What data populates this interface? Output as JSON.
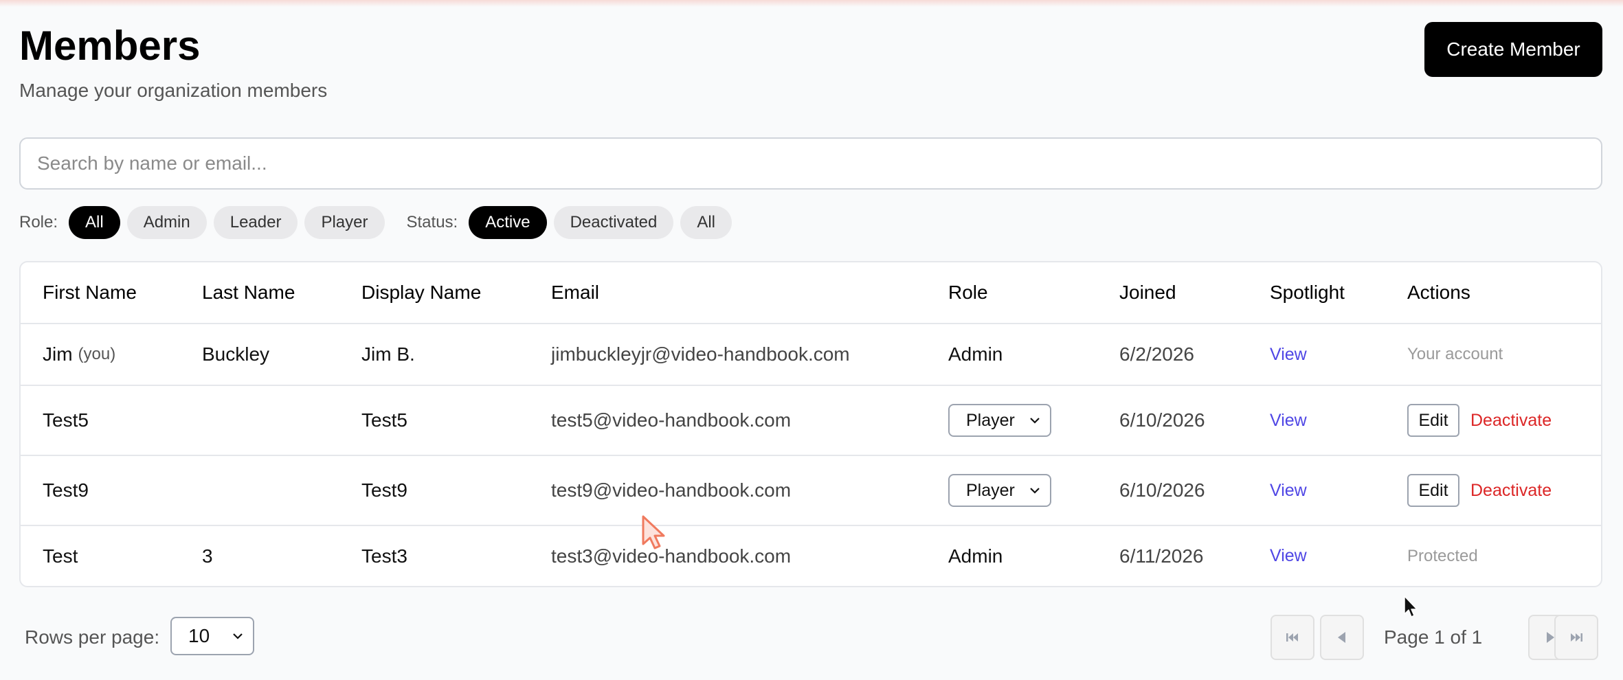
{
  "header": {
    "title": "Members",
    "subtitle": "Manage your organization members",
    "create_button": "Create Member"
  },
  "search": {
    "placeholder": "Search by name or email...",
    "value": ""
  },
  "filters": {
    "role_label": "Role:",
    "role_options": [
      "All",
      "Admin",
      "Leader",
      "Player"
    ],
    "role_selected": "All",
    "status_label": "Status:",
    "status_options": [
      "Active",
      "Deactivated",
      "All"
    ],
    "status_selected": "Active"
  },
  "table": {
    "columns": [
      "First Name",
      "Last Name",
      "Display Name",
      "Email",
      "Role",
      "Joined",
      "Spotlight",
      "Actions"
    ],
    "rows": [
      {
        "first_name": "Jim",
        "you_tag": "(you)",
        "last_name": "Buckley",
        "display_name": "Jim B.",
        "email": "jimbuckleyjr@video-handbook.com",
        "role": "Admin",
        "joined": "6/2/2026",
        "spotlight": "View",
        "action_text": "Your account"
      },
      {
        "first_name": "Test5",
        "last_name": "",
        "display_name": "Test5",
        "email": "test5@video-handbook.com",
        "role": "Player",
        "joined": "6/10/2026",
        "spotlight": "View",
        "edit_label": "Edit",
        "deactivate_label": "Deactivate"
      },
      {
        "first_name": "Test9",
        "last_name": "",
        "display_name": "Test9",
        "email": "test9@video-handbook.com",
        "role": "Player",
        "joined": "6/10/2026",
        "spotlight": "View",
        "edit_label": "Edit",
        "deactivate_label": "Deactivate"
      },
      {
        "first_name": "Test",
        "last_name": "3",
        "display_name": "Test3",
        "email": "test3@video-handbook.com",
        "role": "Admin",
        "joined": "6/11/2026",
        "spotlight": "View",
        "action_text": "Protected"
      }
    ]
  },
  "pagination": {
    "rows_per_page_label": "Rows per page:",
    "rows_per_page": "10",
    "page_info": "Page 1 of 1"
  },
  "colors": {
    "accent": "#000000",
    "link": "#4f46e5",
    "danger": "#dc2626"
  }
}
